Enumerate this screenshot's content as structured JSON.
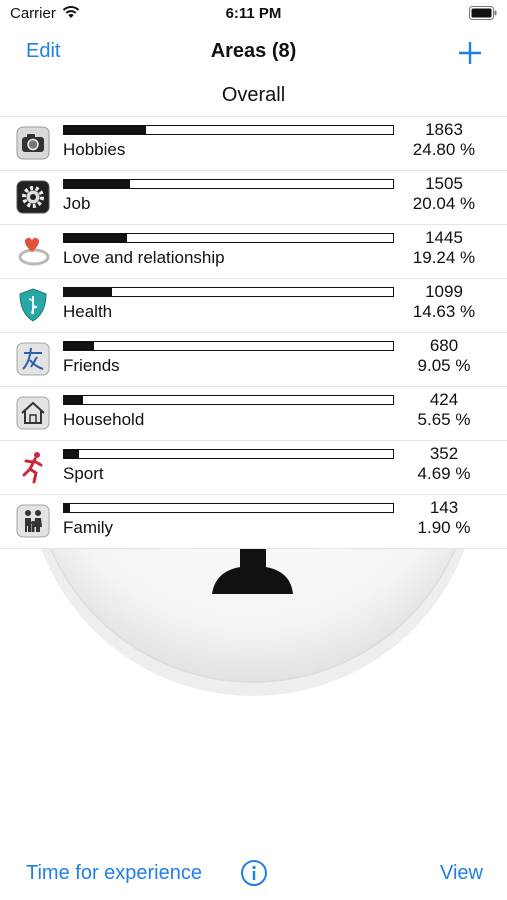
{
  "status_bar": {
    "carrier": "Carrier",
    "time": "6:11 PM"
  },
  "nav": {
    "edit_label": "Edit",
    "title": "Areas (8)",
    "add_icon": "plus-icon"
  },
  "section": {
    "title": "Overall"
  },
  "areas": [
    {
      "label": "Hobbies",
      "count": "1863",
      "percent": "24.80 %",
      "share": 0.248,
      "icon": "camera-icon"
    },
    {
      "label": "Job",
      "count": "1505",
      "percent": "20.04 %",
      "share": 0.2004,
      "icon": "gear-icon"
    },
    {
      "label": "Love and relationship",
      "count": "1445",
      "percent": "19.24 %",
      "share": 0.1924,
      "icon": "ring-heart-icon"
    },
    {
      "label": "Health",
      "count": "1099",
      "percent": "14.63 %",
      "share": 0.1463,
      "icon": "medical-shield-icon"
    },
    {
      "label": "Friends",
      "count": "680",
      "percent": "9.05 %",
      "share": 0.0905,
      "icon": "friend-glyph-icon"
    },
    {
      "label": "Household",
      "count": "424",
      "percent": "5.65 %",
      "share": 0.0565,
      "icon": "house-icon"
    },
    {
      "label": "Sport",
      "count": "352",
      "percent": "4.69 %",
      "share": 0.0469,
      "icon": "runner-icon"
    },
    {
      "label": "Family",
      "count": "143",
      "percent": "1.90 %",
      "share": 0.019,
      "icon": "family-icon"
    }
  ],
  "toolbar": {
    "time_label": "Time for experience",
    "info_icon": "info-icon",
    "view_label": "View"
  },
  "colors": {
    "accent": "#1f7fe6",
    "bar": "#111111"
  }
}
